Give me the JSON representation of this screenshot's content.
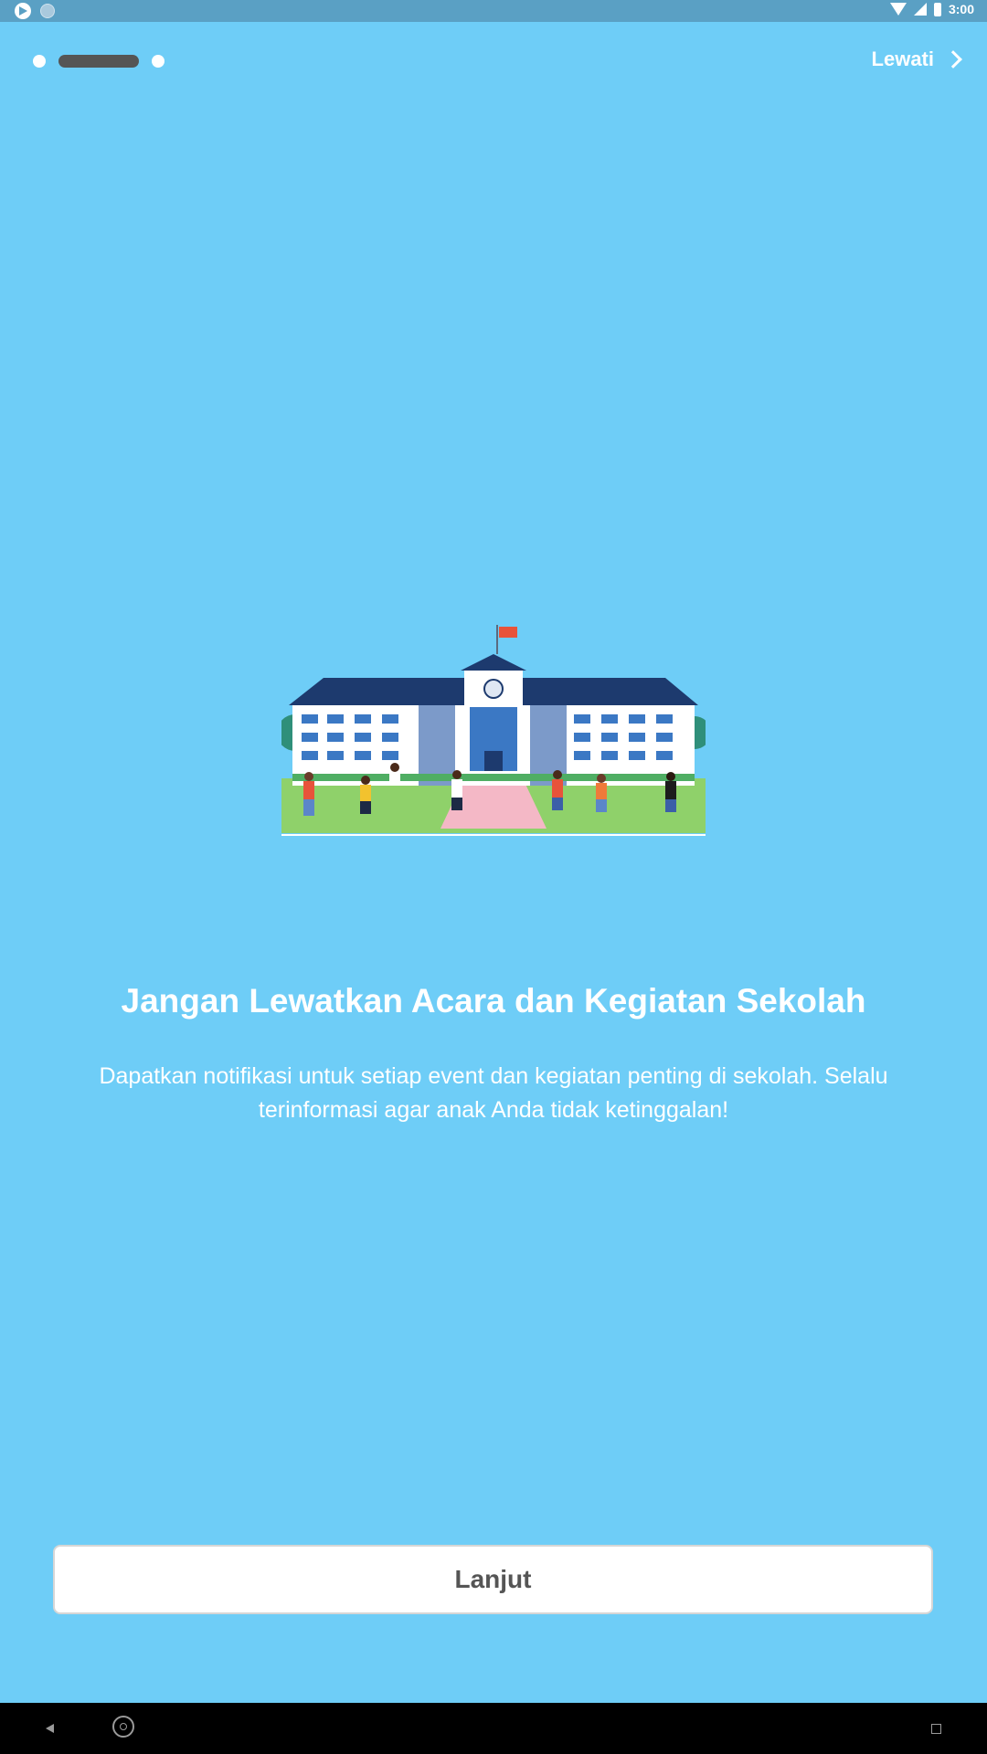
{
  "status_bar": {
    "time": "3:00"
  },
  "pager": {
    "total_pages": 3,
    "current_page": 2
  },
  "header": {
    "skip_label": "Lewati"
  },
  "main": {
    "title": "Jangan Lewatkan Acara dan Kegiatan Sekolah",
    "description": "Dapatkan notifikasi untuk setiap event dan kegiatan penting di sekolah. Selalu terinformasi agar anak Anda tidak ketinggalan!"
  },
  "footer": {
    "next_label": "Lanjut"
  },
  "colors": {
    "background": "#6ecdf7",
    "status_bar": "#5aa0c4",
    "active_indicator": "#555555",
    "button_bg": "#ffffff",
    "button_text": "#555555"
  },
  "icons": [
    "app-notification-icon",
    "sync-icon",
    "wifi-icon",
    "signal-icon",
    "battery-icon",
    "chevron-right-icon",
    "back-nav-icon",
    "home-nav-icon",
    "recents-nav-icon"
  ]
}
